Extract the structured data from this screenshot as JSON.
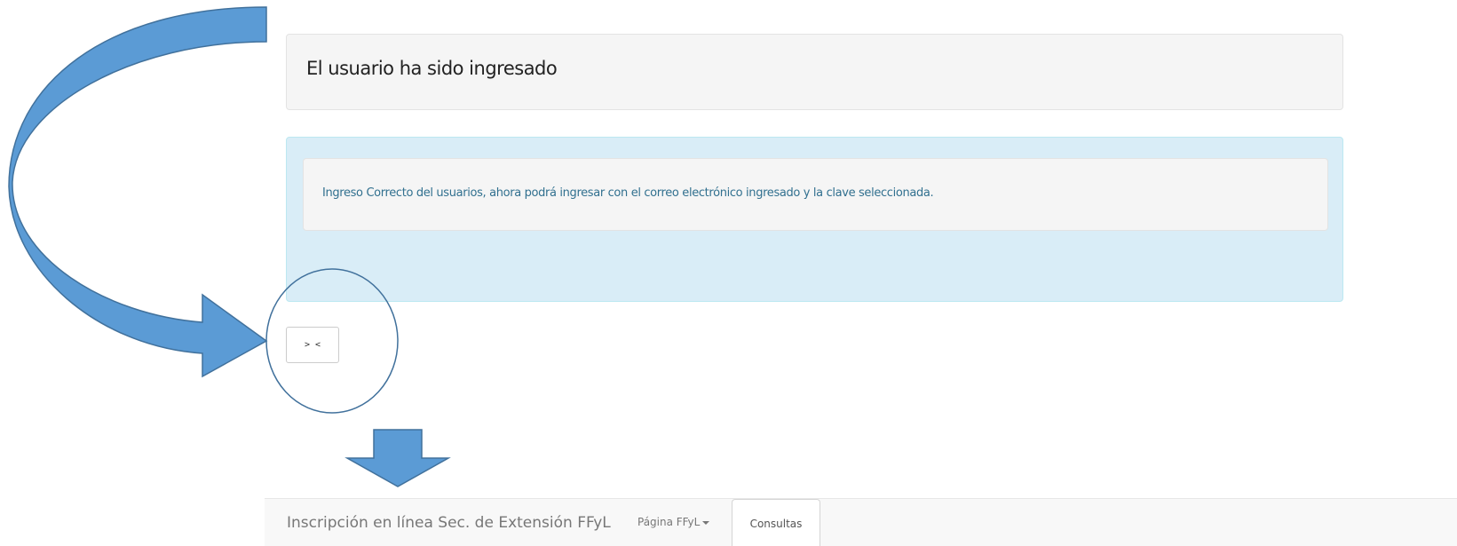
{
  "header": {
    "title": "El usuario ha sido ingresado"
  },
  "alert": {
    "message": "Ingreso Correcto del usuarios, ahora podrá ingresar con el correo electrónico ingresado y la clave seleccionada."
  },
  "toggle_button": {
    "label": "> <"
  },
  "navbar": {
    "brand": "Inscripción en línea Sec. de Extensión FFyL",
    "dropdown_label": "Página FFyL",
    "consultas_label": "Consultas"
  },
  "annotations": {
    "arrow_color": "#5b9bd5",
    "outline_color": "#41719c",
    "curved_arrow": "curved-arrow-icon",
    "circle": "highlight-circle",
    "down_arrow": "down-arrow-icon"
  }
}
